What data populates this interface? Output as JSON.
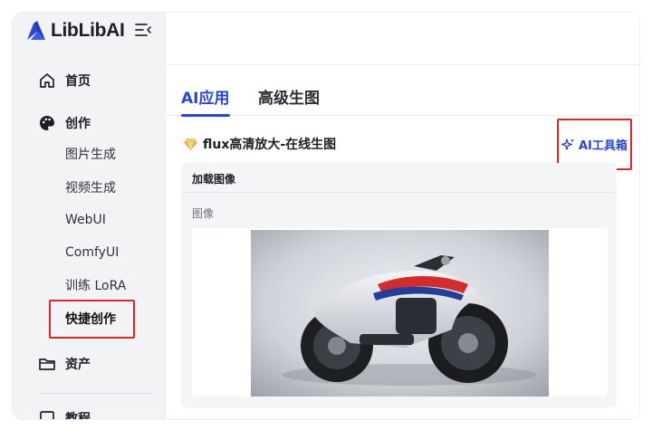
{
  "brand": {
    "name": "LibLibAI",
    "color": "#2a45d6"
  },
  "sidebar": {
    "home_label": "首页",
    "create_label": "创作",
    "sub_items": [
      "图片生成",
      "视频生成",
      "WebUI",
      "ComfyUI",
      "训练 LoRA",
      "快捷创作"
    ],
    "active_item": "快捷创作",
    "assets_label": "资产",
    "tutorial_label": "教程"
  },
  "tabs": [
    {
      "label": "AI应用",
      "active": true
    },
    {
      "label": "高级生图",
      "active": false
    }
  ],
  "tool": {
    "title": "flux高清放大-在线生图",
    "toolbox_link": "AI工具箱"
  },
  "card": {
    "title": "加载图像",
    "field_label": "图像"
  },
  "colors": {
    "accent": "#2a45d6",
    "highlight": "#e02424",
    "sidebar_bg": "#f2f3f5"
  },
  "icons": [
    "home-icon",
    "palette-icon",
    "folder-icon",
    "diamond-icon",
    "sparkle-icon",
    "collapse-sidebar-icon"
  ]
}
